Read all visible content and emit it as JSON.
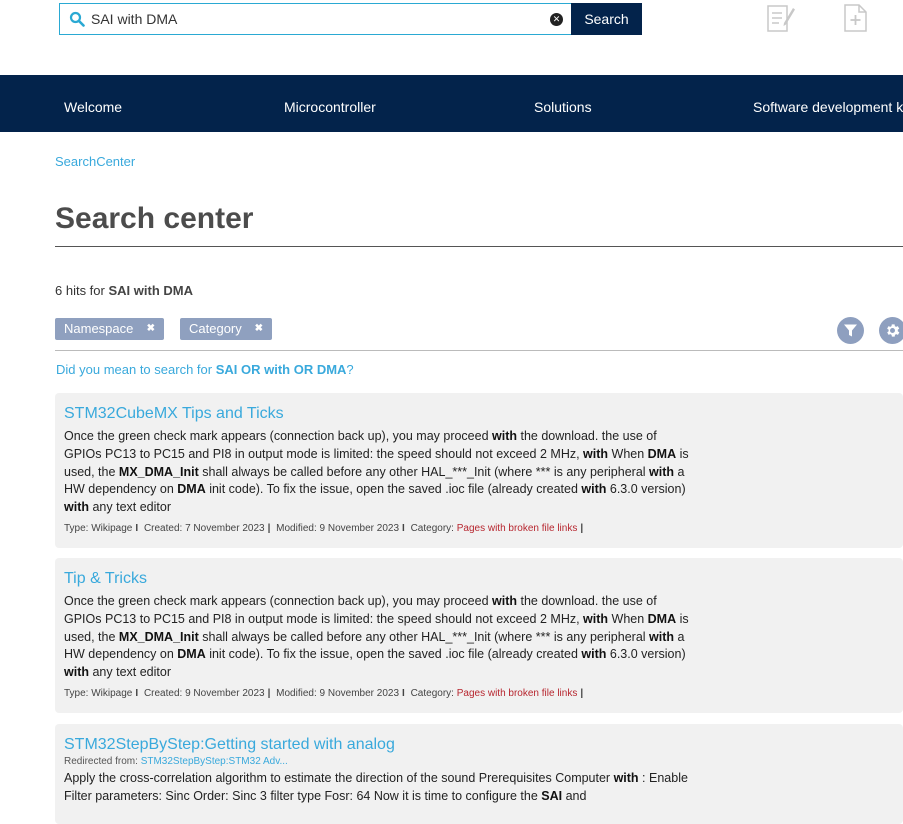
{
  "search": {
    "value": "SAI with DMA",
    "button_label": "Search"
  },
  "nav": {
    "items": [
      "Welcome",
      "Microcontroller",
      "Solutions",
      "Software development kit"
    ]
  },
  "breadcrumb": "SearchCenter",
  "page_title": "Search center",
  "hits": {
    "prefix": "6 hits for",
    "query": "SAI with DMA"
  },
  "filters": [
    {
      "label": "Namespace",
      "remove": "✖"
    },
    {
      "label": "Category",
      "remove": "✖"
    }
  ],
  "suggestion": {
    "prefix": "Did you mean to search for",
    "query": "SAI OR with OR DMA",
    "suffix": "?"
  },
  "results": [
    {
      "title": "STM32CubeMX Tips and Ticks",
      "meta": {
        "type": "Type: Wikipage",
        "created": "Created: 7 November 2023",
        "modified": "Modified: 9 November 2023",
        "category_label": "Category:",
        "category_value": "Pages with broken file links"
      }
    },
    {
      "title": "Tip & Tricks",
      "meta": {
        "type": "Type: Wikipage",
        "created": "Created: 9 November 2023",
        "modified": "Modified: 9 November 2023",
        "category_label": "Category:",
        "category_value": "Pages with broken file links"
      }
    },
    {
      "title": "STM32StepByStep:Getting started with analog",
      "redirect_label": "Redirected from:",
      "redirect_link": "STM32StepByStep:STM32 Adv..."
    }
  ],
  "snippets": {
    "r0": [
      "Once the green check mark appears (connection back up), you may proceed ",
      "with",
      " the download. the use of GPIOs PC13 to PC15 and PI8 in output mode is limited: the speed should not exceed 2 MHz, ",
      "with",
      " When ",
      "DMA",
      " is used, the ",
      "MX_DMA_Init",
      " shall always be called before any other HAL_***_Init (where *** is any peripheral ",
      "with",
      " a HW dependency on ",
      "DMA",
      " init code). To fix the issue, open the saved .ioc file (already created ",
      "with",
      " 6.3.0 version) ",
      "with",
      " any text editor"
    ],
    "r2": [
      "Apply the cross-correlation algorithm to estimate the direction of the sound Prerequisites Computer ",
      "with",
      " : Enable Filter parameters: Sinc Order: Sinc 3 filter type Fosr: 64 Now it is time to configure the ",
      "SAI",
      " and"
    ]
  },
  "colors": {
    "nav_bg": "#03234b",
    "link": "#39a9dc",
    "chip_bg": "#8fa0bf",
    "category_link": "#b7262f",
    "result_bg": "#f1f1f1"
  },
  "icons": [
    "search-icon",
    "clear-icon",
    "edit-page-icon",
    "new-page-icon",
    "filter-icon",
    "gear-icon"
  ]
}
